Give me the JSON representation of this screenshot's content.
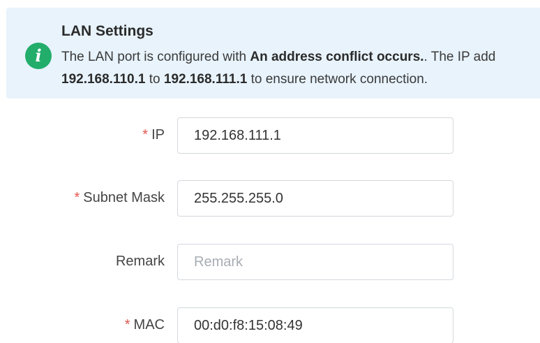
{
  "alert": {
    "icon": "info-icon",
    "title": "LAN Settings",
    "line1_prefix": "The LAN port is configured with ",
    "line1_bold": "An address conflict occurs.",
    "line1_suffix": ". The IP add",
    "line2_from": "192.168.110.1",
    "line2_to_word": " to ",
    "line2_to": "192.168.111.1",
    "line2_suffix": " to ensure network connection."
  },
  "form": {
    "required_mark": "*",
    "ip": {
      "label": "IP",
      "value": "192.168.111.1"
    },
    "subnet_mask": {
      "label": "Subnet Mask",
      "value": "255.255.255.0"
    },
    "remark": {
      "label": "Remark",
      "value": "",
      "placeholder": "Remark"
    },
    "mac": {
      "label": "MAC",
      "value": "00:d0:f8:15:08:49"
    }
  },
  "colors": {
    "alert_background": "#e8f3fc",
    "info_icon": "#22ad6b",
    "required_mark": "#e5574f",
    "input_border": "#d4d8dd"
  }
}
